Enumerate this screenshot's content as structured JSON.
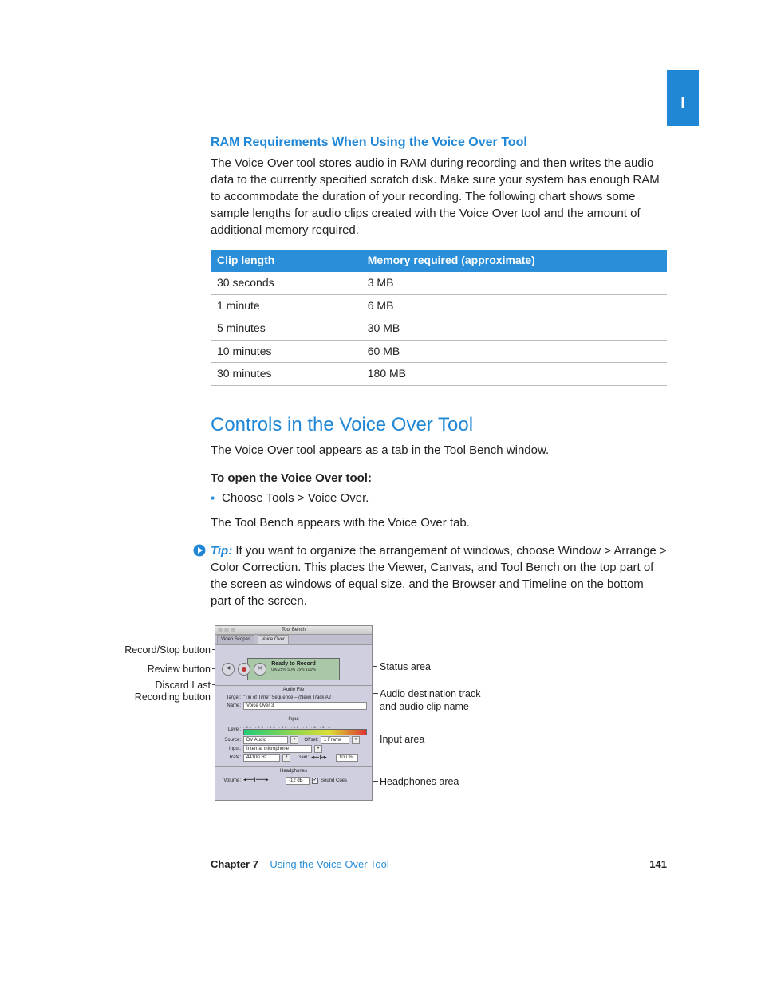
{
  "thumbTab": "I",
  "heading1": "RAM Requirements When Using the Voice Over Tool",
  "para1": "The Voice Over tool stores audio in RAM during recording and then writes the audio data to the currently specified scratch disk. Make sure your system has enough RAM to accommodate the duration of your recording. The following chart shows some sample lengths for audio clips created with the Voice Over tool and the amount of additional memory required.",
  "table": {
    "headers": [
      "Clip length",
      "Memory required (approximate)"
    ],
    "rows": [
      [
        "30 seconds",
        "3 MB"
      ],
      [
        "1 minute",
        "6 MB"
      ],
      [
        "5 minutes",
        "30 MB"
      ],
      [
        "10 minutes",
        "60 MB"
      ],
      [
        "30 minutes",
        "180 MB"
      ]
    ]
  },
  "heading2": "Controls in the Voice Over Tool",
  "para2": "The Voice Over tool appears as a tab in the Tool Bench window.",
  "openHeader": "To open the Voice Over tool:",
  "bullet1": "Choose Tools > Voice Over.",
  "para3": "The Tool Bench appears with the Voice Over tab.",
  "tipLabel": "Tip:",
  "tipBody": "If you want to organize the arrangement of windows, choose Window > Arrange > Color Correction. This places the Viewer, Canvas, and Tool Bench on the top part of the screen as windows of equal size, and the Browser and Timeline on the bottom part of the screen.",
  "figure": {
    "windowTitle": "Tool Bench",
    "tab1": "Video Scopes",
    "tab2": "Voice Over",
    "statusReady": "Ready to Record",
    "statusMeter": "0%   25%   50%   75%   100%",
    "audioFileHead": "Audio File",
    "targetLabel": "Target:",
    "targetValue": "\"Tin of Time\" Sequence – (New) Track A2",
    "nameLabel": "Name:",
    "nameValue": "Voice Over 3",
    "inputHead": "Input",
    "levelLabel": "Level:",
    "levelTicks": "-30  -25  -20  -15  -12  -9  -6  -3   0",
    "sourceLabel": "Source:",
    "sourceValue": "DV Audio",
    "offsetLabel": "Offset:",
    "offsetValue": "1 Frame",
    "inputLabel": "Input:",
    "inputValue": "Internal microphone",
    "rateLabel": "Rate:",
    "rateValue": "44100 Hz",
    "gainLabel": "Gain:",
    "gainValue": "100 %",
    "headphonesHead": "Headphones",
    "volumeLabel": "Volume:",
    "volumeValue": "-12 dB",
    "soundCues": "Sound Cues"
  },
  "callouts": {
    "l1": "Record/Stop button",
    "l2": "Review button",
    "l3a": "Discard Last",
    "l3b": "Recording button",
    "r1": "Status area",
    "r2a": "Audio destination track",
    "r2b": "and audio clip name",
    "r3": "Input area",
    "r4": "Headphones area"
  },
  "footer": {
    "chapter": "Chapter 7",
    "title": "Using the Voice Over Tool",
    "page": "141"
  },
  "chart_data": {
    "type": "table",
    "title": "RAM required vs. clip length (approximate)",
    "columns": [
      "Clip length",
      "Memory required (MB)"
    ],
    "rows": [
      [
        "30 seconds",
        3
      ],
      [
        "1 minute",
        6
      ],
      [
        "5 minutes",
        30
      ],
      [
        "10 minutes",
        60
      ],
      [
        "30 minutes",
        180
      ]
    ]
  }
}
